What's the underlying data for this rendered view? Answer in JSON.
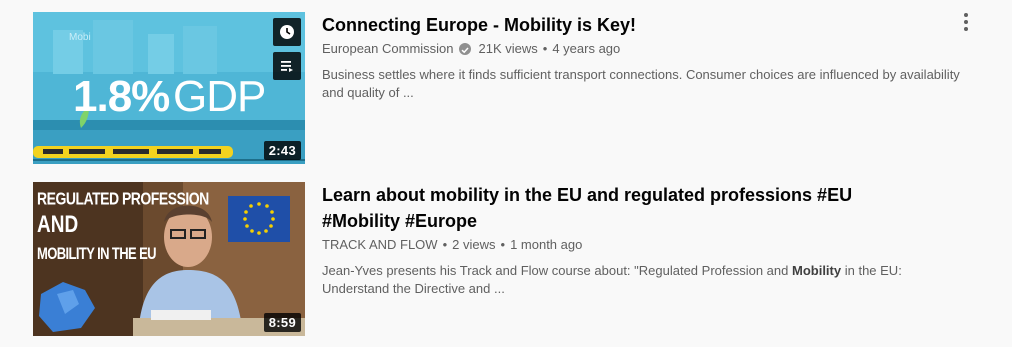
{
  "results": [
    {
      "title": "Connecting Europe - Mobility is Key!",
      "channel": "European Commission",
      "verified": true,
      "views": "21K views",
      "age": "4 years ago",
      "description": "Business settles where it finds sufficient transport connections. Consumer choices are influenced by availability and quality of ...",
      "duration": "2:43",
      "thumb_text": {
        "big": "1.8%",
        "small": "GDP",
        "corner": "Mobi"
      },
      "hover_buttons": [
        "clock-icon",
        "add-to-queue-icon"
      ],
      "colors": {
        "thumb_bg": "#4fb6d6",
        "train": "#f2d21f"
      }
    },
    {
      "title_line1": "Learn about mobility in the EU and regulated professions #EU",
      "title_line2": "#Mobility #Europe",
      "channel": "TRACK AND FLOW",
      "views": "2 views",
      "age": "1 month ago",
      "description_pre": "Jean-Yves presents his Track and Flow course about: \"Regulated Profession and ",
      "description_bold": "Mobility",
      "description_post": " in the EU:",
      "description_line2": "Understand the Directive and ...",
      "duration": "8:59",
      "thumb_text": {
        "line1": "REGULATED PROFESSION",
        "line2": "AND",
        "line3": "MOBILITY IN THE EU"
      },
      "colors": {
        "thumb_bg": "#6b4a2e",
        "eu_flag": "#1f4fa8",
        "map": "#3a7fd5"
      }
    }
  ],
  "separator": "•"
}
